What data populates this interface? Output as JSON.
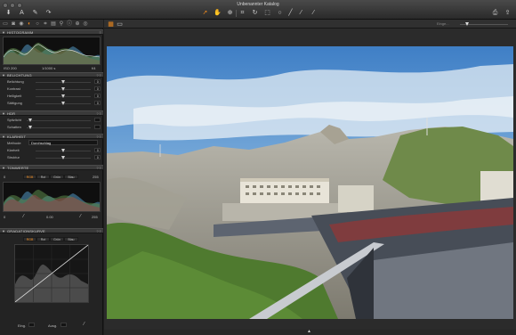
{
  "window": {
    "title": "Unbenannter Katalog"
  },
  "toolbar": {
    "left_icons": [
      "import-icon",
      "text-tool-icon",
      "pen-icon",
      "redo-icon"
    ],
    "cursor_icons": [
      "select-cursor-icon",
      "pan-icon",
      "zoom-icon",
      "crop-icon",
      "rotate-icon",
      "keystone-icon",
      "spot-icon",
      "picker-icon",
      "brush-icon",
      "eyedropper-icon"
    ],
    "right_icons": [
      "print-icon",
      "share-icon"
    ]
  },
  "tool_tabs": [
    "library-icon",
    "capture-icon",
    "color-icon",
    "exposure-icon",
    "lens-icon",
    "crop-tab-icon",
    "details-icon",
    "local-icon",
    "metadata-icon",
    "output-icon",
    "batch-icon"
  ],
  "histogram": {
    "section_label": "HISTOGRAMM",
    "iso": "ISO 200",
    "shutter": "1/1000 s",
    "aperture": "f/4"
  },
  "exposure": {
    "section_label": "BELICHTUNG",
    "rows": [
      {
        "label": "Belichtung",
        "value": "0"
      },
      {
        "label": "Kontrast",
        "value": "0"
      },
      {
        "label": "Helligkeit",
        "value": "0"
      },
      {
        "label": "Sättigung",
        "value": "0"
      }
    ]
  },
  "hdr": {
    "section_label": "HDR",
    "rows": [
      {
        "label": "Spitzlicht",
        "value": ""
      },
      {
        "label": "Schatten",
        "value": ""
      }
    ]
  },
  "clarity": {
    "section_label": "KLARHEIT",
    "method_label": "Methode",
    "method_value": "Durchschlag",
    "rows": [
      {
        "label": "Klarheit",
        "value": "0"
      },
      {
        "label": "Struktur",
        "value": "0"
      }
    ]
  },
  "levels": {
    "section_label": "TONWERTE",
    "channels": [
      "RGB",
      "Rot",
      "Grün",
      "Blau"
    ],
    "left_val": "0",
    "right_val": "255",
    "bottom_left": "0",
    "bottom_mid": "0.00",
    "bottom_right": "255"
  },
  "curve": {
    "section_label": "GRADATIONSKURVE",
    "channels": [
      "RGB",
      "Rot",
      "Grün",
      "Blau"
    ],
    "input_label": "Eing.",
    "output_label": "Ausg."
  },
  "viewer": {
    "zoom_label": "Einge..."
  },
  "colors": {
    "accent": "#f08a1c",
    "panel": "#232323",
    "section": "#3a3a3a"
  }
}
